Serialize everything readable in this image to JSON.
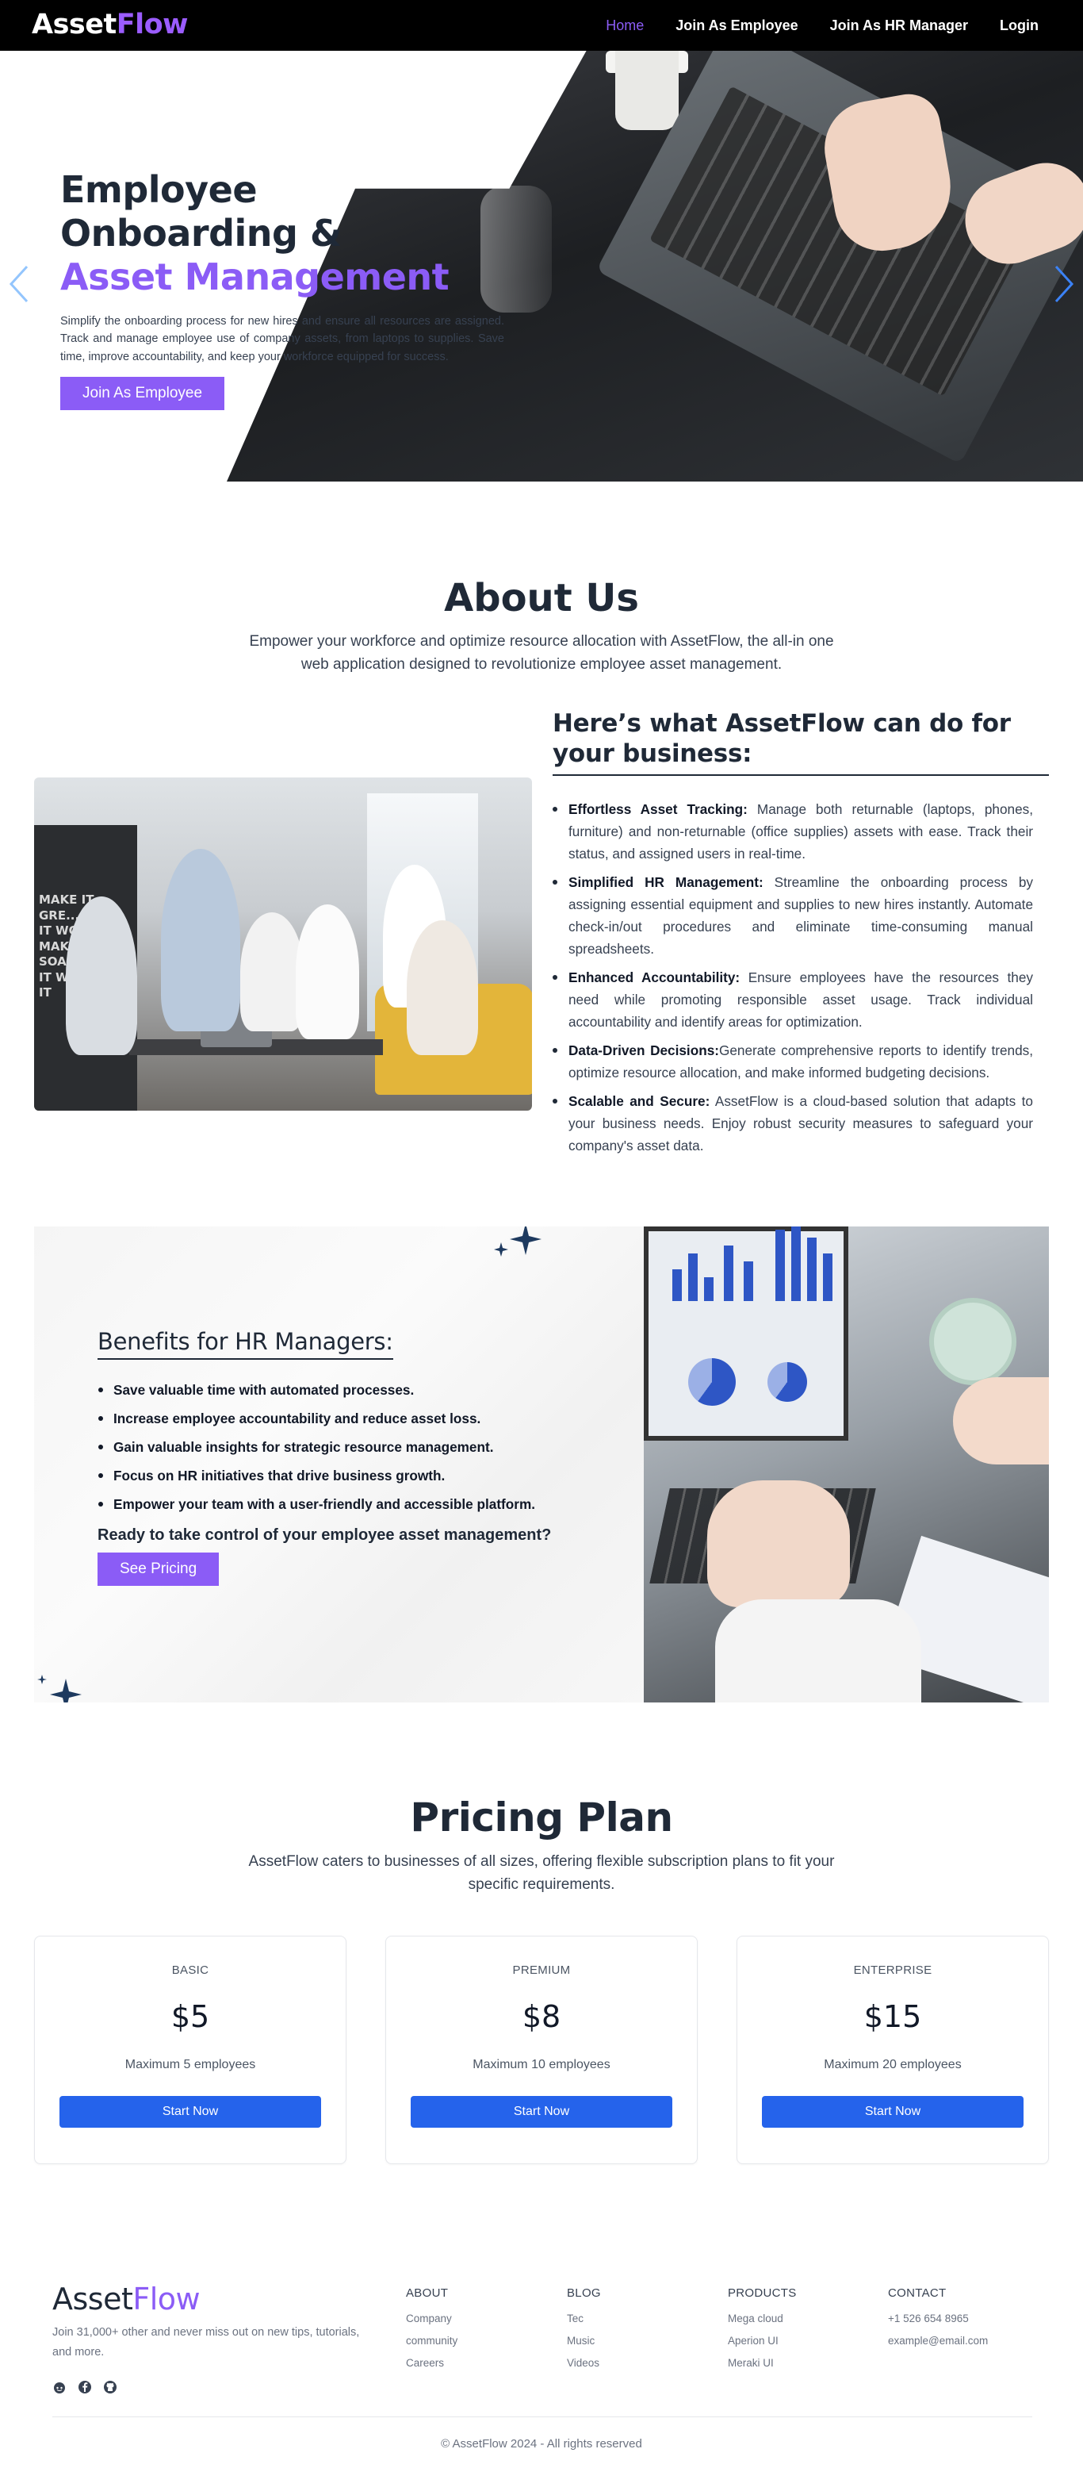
{
  "nav": {
    "logo_main": "Asset",
    "logo_accent": "Flow",
    "links": [
      "Home",
      "Join As Employee",
      "Join As HR Manager",
      "Login"
    ]
  },
  "hero": {
    "title_line1": "Employee Onboarding &",
    "title_line2": "Asset Management",
    "description": "Simplify the onboarding process for new hires and ensure all resources are assigned. Track and manage employee use of company assets, from laptops to supplies. Save time, improve accountability, and keep your workforce equipped for success.",
    "cta": "Join As Employee"
  },
  "about": {
    "title": "About Us",
    "subtitle": "Empower your workforce and optimize resource allocation with AssetFlow, the all-in one web application designed to revolutionize employee asset management.",
    "photo_wall_text": "MAKE IT GRE... MAKE IT WOW MAKE IT SOAR MAKE IT WOR MAKE IT"
  },
  "features": {
    "heading": "Here’s what AssetFlow can do for your business:",
    "items": [
      {
        "title": "Effortless Asset Tracking:",
        "text": " Manage both returnable (laptops, phones, furniture) and non-returnable (office supplies) assets with ease. Track their status, and assigned users in real-time."
      },
      {
        "title": "Simplified HR Management:",
        "text": " Streamline the onboarding process by assigning essential equipment and supplies to new hires instantly. Automate check-in/out procedures and eliminate time-consuming manual spreadsheets."
      },
      {
        "title": "Enhanced Accountability:",
        "text": " Ensure employees have the resources they need while promoting responsible asset usage. Track individual accountability and identify areas for optimization."
      },
      {
        "title": "Data-Driven Decisions:",
        "text": "Generate comprehensive reports to identify trends, optimize resource allocation, and make informed budgeting decisions."
      },
      {
        "title": "Scalable and Secure:",
        "text": " AssetFlow is a cloud-based solution that adapts to your business needs. Enjoy robust security measures to safeguard your company's asset data."
      }
    ]
  },
  "benefits": {
    "heading": "Benefits for HR Managers:",
    "items": [
      "Save valuable time with automated processes.",
      "Increase employee accountability and reduce asset loss.",
      "Gain valuable insights for strategic resource management.",
      "Focus on HR initiatives that drive business growth.",
      "Empower your team with a user-friendly and accessible platform."
    ],
    "question": "Ready to take control of your employee asset management?",
    "cta": "See Pricing"
  },
  "pricing": {
    "title": "Pricing Plan",
    "subtitle": "AssetFlow caters to businesses of all sizes, offering flexible subscription plans to fit your specific requirements.",
    "plans": [
      {
        "name": "BASIC",
        "price": "$5",
        "limit": "Maximum 5 employees",
        "cta": "Start Now"
      },
      {
        "name": "PREMIUM",
        "price": "$8",
        "limit": "Maximum 10 employees",
        "cta": "Start Now"
      },
      {
        "name": "ENTERPRISE",
        "price": "$15",
        "limit": "Maximum 20 employees",
        "cta": "Start Now"
      }
    ]
  },
  "footer": {
    "logo_main": "Asset",
    "logo_accent": "Flow",
    "tagline": "Join 31,000+ other and never miss out on new tips, tutorials, and more.",
    "socials": [
      "reddit-icon",
      "facebook-icon",
      "github-icon"
    ],
    "columns": [
      {
        "title": "ABOUT",
        "links": [
          "Company",
          "community",
          "Careers"
        ]
      },
      {
        "title": "BLOG",
        "links": [
          "Tec",
          "Music",
          "Videos"
        ]
      },
      {
        "title": "PRODUCTS",
        "links": [
          "Mega cloud",
          "Aperion UI",
          "Meraki UI"
        ]
      },
      {
        "title": "CONTACT",
        "links": [
          "+1 526 654 8965",
          "example@email.com"
        ]
      }
    ],
    "copyright": "© AssetFlow 2024 - All rights reserved"
  },
  "colors": {
    "accent": "#8b5cf6",
    "primary_button": "#2563eb",
    "nav_bg": "#000000",
    "arrow": "#3b82f6"
  }
}
